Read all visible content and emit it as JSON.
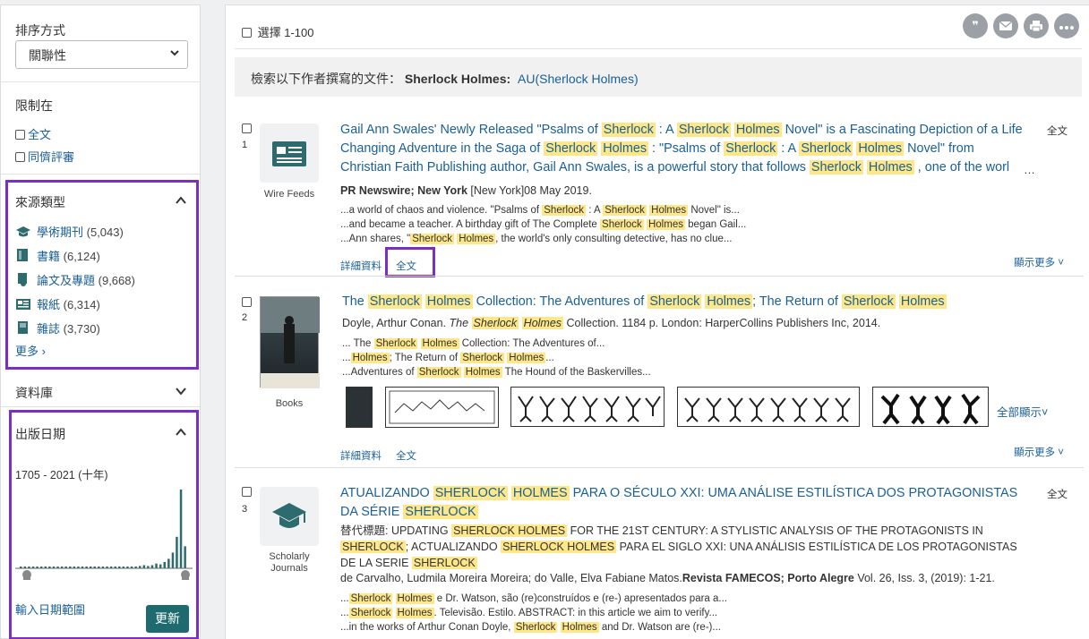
{
  "sidebar": {
    "sort_label": "排序方式",
    "sort_value": "關聯性",
    "limit_label": "限制在",
    "limit_options": [
      "全文",
      "同儕評審"
    ],
    "source_type_label": "來源類型",
    "source_types": [
      {
        "label": "學術期刊",
        "count": "(5,043)",
        "icon": "mortarboard-icon"
      },
      {
        "label": "書籍",
        "count": "(6,124)",
        "icon": "book-icon"
      },
      {
        "label": "論文及專題",
        "count": "(9,668)",
        "icon": "dissertation-icon"
      },
      {
        "label": "報紙",
        "count": "(6,314)",
        "icon": "newspaper-icon"
      },
      {
        "label": "雜誌",
        "count": "(3,730)",
        "icon": "magazine-icon"
      }
    ],
    "more_label": "更多 ›",
    "database_label": "資料庫",
    "pubdate_label": "出版日期",
    "pubdate_range": "1705 - 2021 (十年)",
    "date_range_link": "輸入日期範圍",
    "update_button": "更新"
  },
  "histogram": {
    "bar_heights": [
      0.02,
      0.02,
      0.02,
      0.02,
      0.02,
      0.02,
      0.02,
      0.02,
      0.02,
      0.02,
      0.02,
      0.02,
      0.02,
      0.02,
      0.02,
      0.02,
      0.02,
      0.02,
      0.02,
      0.02,
      0.02,
      0.02,
      0.02,
      0.02,
      0.02,
      0.02,
      0.02,
      0.02,
      0.02,
      0.03,
      0.04,
      0.03,
      0.04,
      0.06,
      0.05,
      0.08,
      0.12,
      0.2,
      0.4,
      1.0,
      0.28
    ]
  },
  "main": {
    "select_label": "選擇 1-100",
    "tools": [
      "quote-icon",
      "email-icon",
      "print-icon",
      "more-icon"
    ],
    "search_prefix": "檢索以下作者撰寫的文件：",
    "search_author": "Sherlock Holmes:",
    "search_query": "AU(Sherlock Holmes)",
    "detail_label": "詳細資料",
    "fulltext_label": "全文",
    "show_more_label": "顯示更多 ˅",
    "show_all_label": "全部顯示˅",
    "results": [
      {
        "num": "1",
        "type": "Wire Feeds",
        "meta_source": "PR Newswire; New York",
        "meta_rest": " [New York]08 May 2019."
      },
      {
        "num": "2",
        "type": "Books",
        "meta": "Doyle, Arthur Conan.",
        "meta_tail": " Collection. 1184 p. London: HarperCollins Publishers Inc, 2014."
      },
      {
        "num": "3",
        "type": "Scholarly Journals",
        "meta": "de Carvalho, Ludmila Moreira Moreira; do Valle, Elva Fabiane Matos.",
        "meta_bold": "Revista FAMECOS; Porto Alegre",
        "meta_tail": " Vol. 26, Iss. 3,  (2019): 1-21."
      }
    ]
  },
  "colors": {
    "accent_purple": "#7b2fbe",
    "link_blue": "#1a5f96",
    "highlight": "#fde789",
    "button_teal": "#1e6b6f"
  }
}
